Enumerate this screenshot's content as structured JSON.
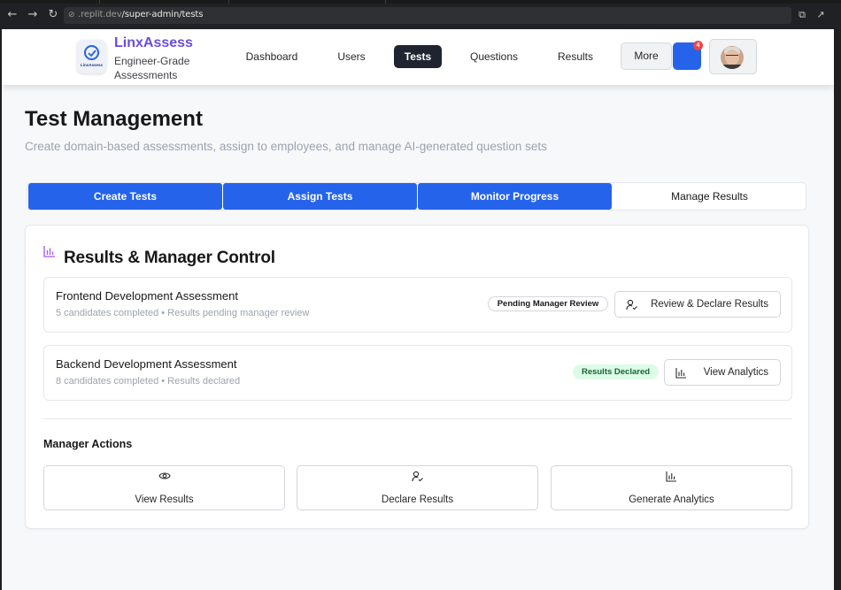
{
  "browser": {
    "url_dim": ".replit.dev",
    "url_path": "/super-admin/tests"
  },
  "header": {
    "brand_name": "LinxAssess",
    "brand_tagline": "Engineer-Grade Assessments",
    "logo_mini_text": "LinxAssess",
    "nav": [
      {
        "label": "Dashboard",
        "active": false
      },
      {
        "label": "Users",
        "active": false
      },
      {
        "label": "Tests",
        "active": true
      },
      {
        "label": "Questions",
        "active": false
      },
      {
        "label": "Results",
        "active": false
      }
    ],
    "more_label": "More",
    "notification_count": "4"
  },
  "page": {
    "title": "Test Management",
    "subtitle": "Create domain-based assessments, assign to employees, and manage AI-generated question sets"
  },
  "steps": [
    {
      "label": "Create Tests",
      "state": "completed"
    },
    {
      "label": "Assign Tests",
      "state": "completed"
    },
    {
      "label": "Monitor Progress",
      "state": "completed"
    },
    {
      "label": "Manage Results",
      "state": "current"
    }
  ],
  "results_card": {
    "title": "Results & Manager Control",
    "tests": [
      {
        "name": "Frontend Development Assessment",
        "meta": "5 candidates completed • Results pending manager review",
        "status": "Pending Manager Review",
        "action": "Review & Declare Results"
      },
      {
        "name": "Backend Development Assessment",
        "meta": "8 candidates completed • Results declared",
        "status": "Results Declared",
        "action": "View Analytics"
      }
    ],
    "manager_actions_title": "Manager Actions",
    "manager_actions": [
      {
        "label": "View Results",
        "icon": "eye-icon"
      },
      {
        "label": "Declare Results",
        "icon": "user-check-icon"
      },
      {
        "label": "Generate Analytics",
        "icon": "bar-chart-icon"
      }
    ]
  },
  "colors": {
    "brand": "#6a4be0",
    "primary": "#2563eb",
    "nav_active": "#1f2430",
    "success_bg": "#dcfce7",
    "danger": "#ef4444"
  }
}
